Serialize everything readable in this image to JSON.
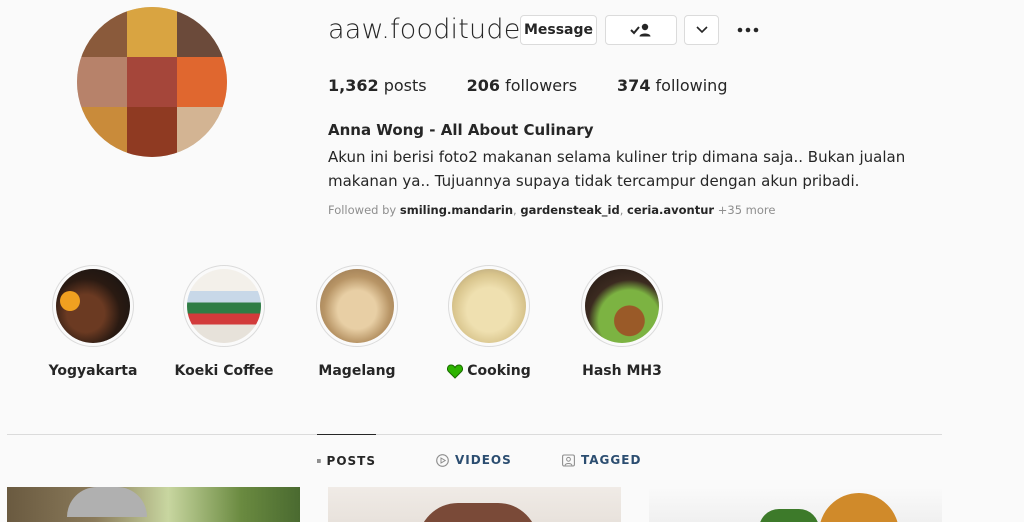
{
  "profile": {
    "username": "aaw.fooditude",
    "buttons": {
      "message": "Message"
    },
    "stats": [
      {
        "count": "1,362",
        "label": "posts"
      },
      {
        "count": "206",
        "label": "followers"
      },
      {
        "count": "374",
        "label": "following"
      }
    ],
    "full_name": "Anna Wong - All About Culinary",
    "bio": "Akun ini berisi foto2 makanan selama kuliner trip dimana saja.. Bukan jualan makanan ya.. Tujuannya supaya tidak tercampur dengan akun pribadi.",
    "followed_by": {
      "prefix": "Followed by",
      "accounts": [
        "smiling.mandarin",
        "gardensteak_id",
        "ceria.avontur"
      ],
      "more": "+35 more"
    }
  },
  "highlights": [
    {
      "label": "Yogyakarta"
    },
    {
      "label": "Koeki Coffee"
    },
    {
      "label": "Magelang"
    },
    {
      "label": "Cooking",
      "icon": "green-heart-icon"
    },
    {
      "label": "Hash MH3"
    }
  ],
  "tabs": [
    {
      "label": "POSTS",
      "icon": "grid-icon",
      "active": true
    },
    {
      "label": "VIDEOS",
      "icon": "play-circle-icon",
      "active": false
    },
    {
      "label": "TAGGED",
      "icon": "tag-person-icon",
      "active": false
    }
  ],
  "colors": {
    "background": "#fafafa",
    "text": "#262626",
    "muted": "#8e8e8e",
    "border": "#dbdbdb",
    "tab_inactive": "#2b4d70",
    "heart": "#2db400"
  }
}
